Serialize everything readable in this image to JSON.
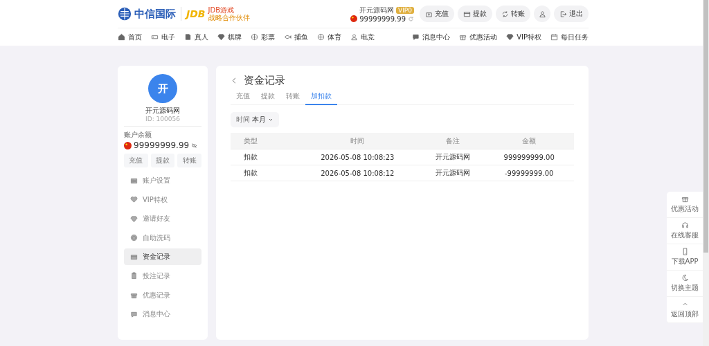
{
  "header": {
    "logo": {
      "name": "中信国际",
      "partner_mark": "JDB",
      "partner_name": "JDB游戏",
      "partner_tagline": "战略合作伙伴"
    },
    "user": {
      "name": "开元源码网",
      "vip_badge": "VIP0",
      "balance": "99999999.99"
    },
    "actions": [
      "充值",
      "提款",
      "转账",
      "退出"
    ]
  },
  "nav": {
    "items": [
      "首页",
      "电子",
      "真人",
      "棋牌",
      "彩票",
      "捕鱼",
      "体育",
      "电竞"
    ],
    "right_items": [
      "消息中心",
      "优惠活动",
      "VIP特权",
      "每日任务"
    ]
  },
  "sidebar": {
    "avatar": "开",
    "username": "开元源码网",
    "user_id": "ID: 100056",
    "balance_label": "账户余额",
    "balance": "99999999.99",
    "quick_buttons": [
      "充值",
      "提款",
      "转账"
    ],
    "menu": [
      {
        "label": "账户设置",
        "selected": false
      },
      {
        "label": "VIP特权",
        "selected": false
      },
      {
        "label": "邀请好友",
        "selected": false
      },
      {
        "label": "自助洗码",
        "selected": false
      },
      {
        "label": "资金记录",
        "selected": true
      },
      {
        "label": "投注记录",
        "selected": false
      },
      {
        "label": "优惠记录",
        "selected": false
      },
      {
        "label": "消息中心",
        "selected": false
      }
    ]
  },
  "main": {
    "title": "资金记录",
    "tabs": [
      {
        "label": "充值",
        "selected": false
      },
      {
        "label": "提款",
        "selected": false
      },
      {
        "label": "转账",
        "selected": false
      },
      {
        "label": "加扣款",
        "selected": true
      }
    ],
    "filter": {
      "label": "时间",
      "value": "本月"
    },
    "table": {
      "columns": [
        "类型",
        "时间",
        "备注",
        "金额"
      ],
      "rows": [
        [
          "扣款",
          "2026-05-08 10:08:23",
          "开元源码网",
          "999999999.00"
        ],
        [
          "扣款",
          "2026-05-08 10:08:12",
          "开元源码网",
          "-99999999.00"
        ]
      ]
    }
  },
  "float_panel": [
    "优惠活动",
    "在线客服",
    "下载APP",
    "切换主题",
    "返回顶部"
  ]
}
